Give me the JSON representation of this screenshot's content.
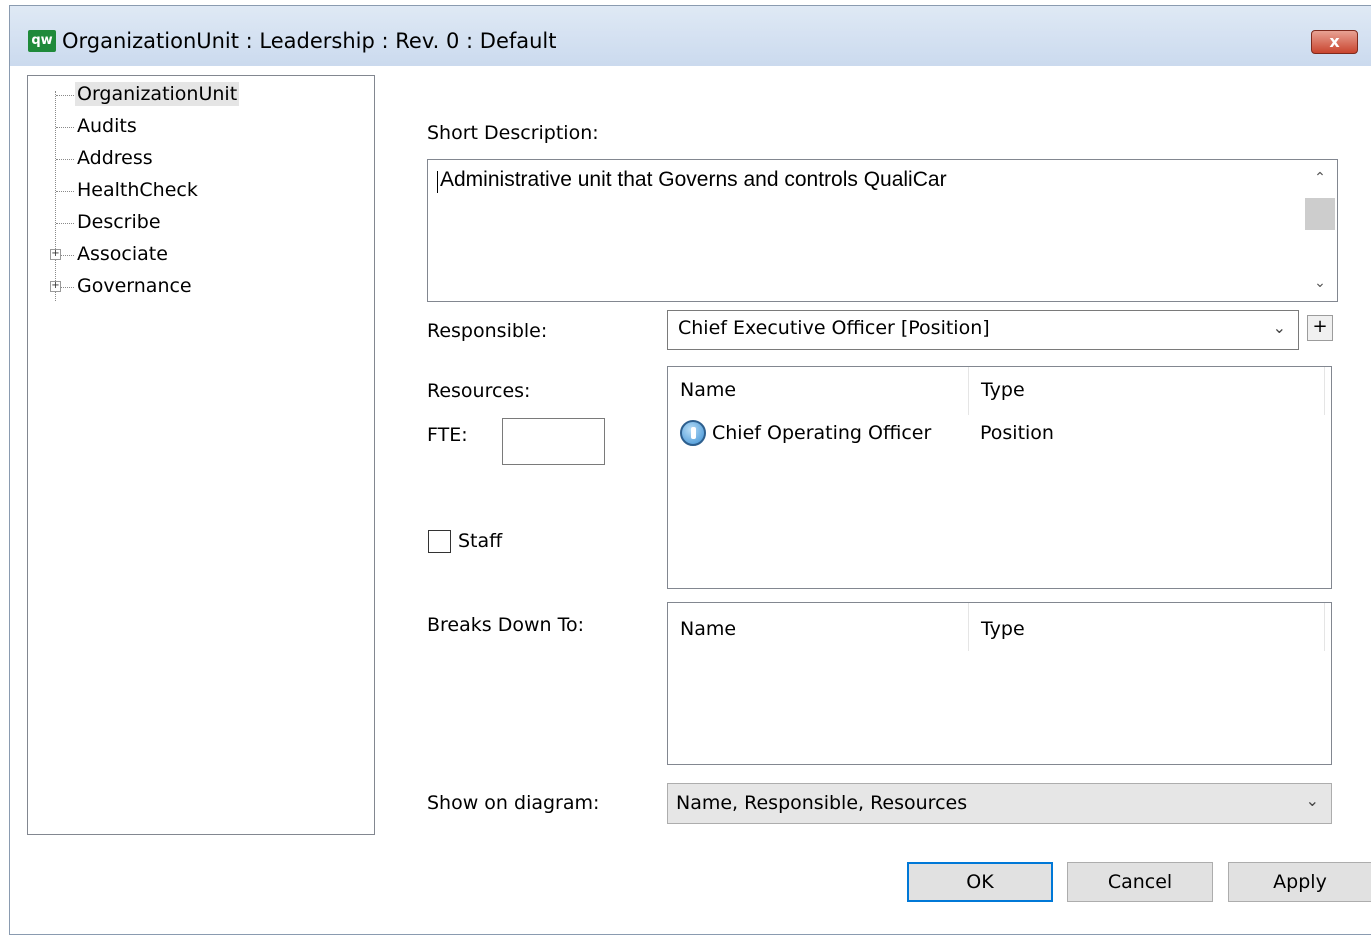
{
  "window": {
    "icon_text": "qw",
    "title": "OrganizationUnit : Leadership : Rev. 0  : Default",
    "close_label": "x"
  },
  "tree": {
    "items": [
      {
        "label": "OrganizationUnit",
        "selected": true,
        "expandable": false
      },
      {
        "label": "Audits",
        "selected": false,
        "expandable": false
      },
      {
        "label": "Address",
        "selected": false,
        "expandable": false
      },
      {
        "label": "HealthCheck",
        "selected": false,
        "expandable": false
      },
      {
        "label": "Describe",
        "selected": false,
        "expandable": false
      },
      {
        "label": "Associate",
        "selected": false,
        "expandable": true
      },
      {
        "label": "Governance",
        "selected": false,
        "expandable": true
      }
    ],
    "expander_glyph": "+"
  },
  "form": {
    "short_description_label": "Short Description:",
    "short_description_value": "Administrative unit that Governs and controls QualiCar",
    "responsible_label": "Responsible:",
    "responsible_value": "Chief Executive Officer [Position]",
    "add_label": "+",
    "resources_label": "Resources:",
    "fte_label": "FTE:",
    "fte_value": "",
    "staff_label": "Staff",
    "staff_checked": false,
    "resources_grid": {
      "columns": [
        "Name",
        "Type"
      ],
      "rows": [
        {
          "name": "Chief Operating Officer",
          "type": "Position",
          "icon": "position-icon"
        }
      ]
    },
    "breaks_down_label": "Breaks Down To:",
    "breaks_down_grid": {
      "columns": [
        "Name",
        "Type"
      ],
      "rows": []
    },
    "show_on_diagram_label": "Show on diagram:",
    "show_on_diagram_value": "Name, Responsible, Resources"
  },
  "buttons": {
    "ok": "OK",
    "cancel": "Cancel",
    "apply": "Apply"
  },
  "colors": {
    "accent": "#0078d7",
    "titlebar": "#cbdaee",
    "close": "#c9452f",
    "app_icon": "#1f8a3a"
  }
}
